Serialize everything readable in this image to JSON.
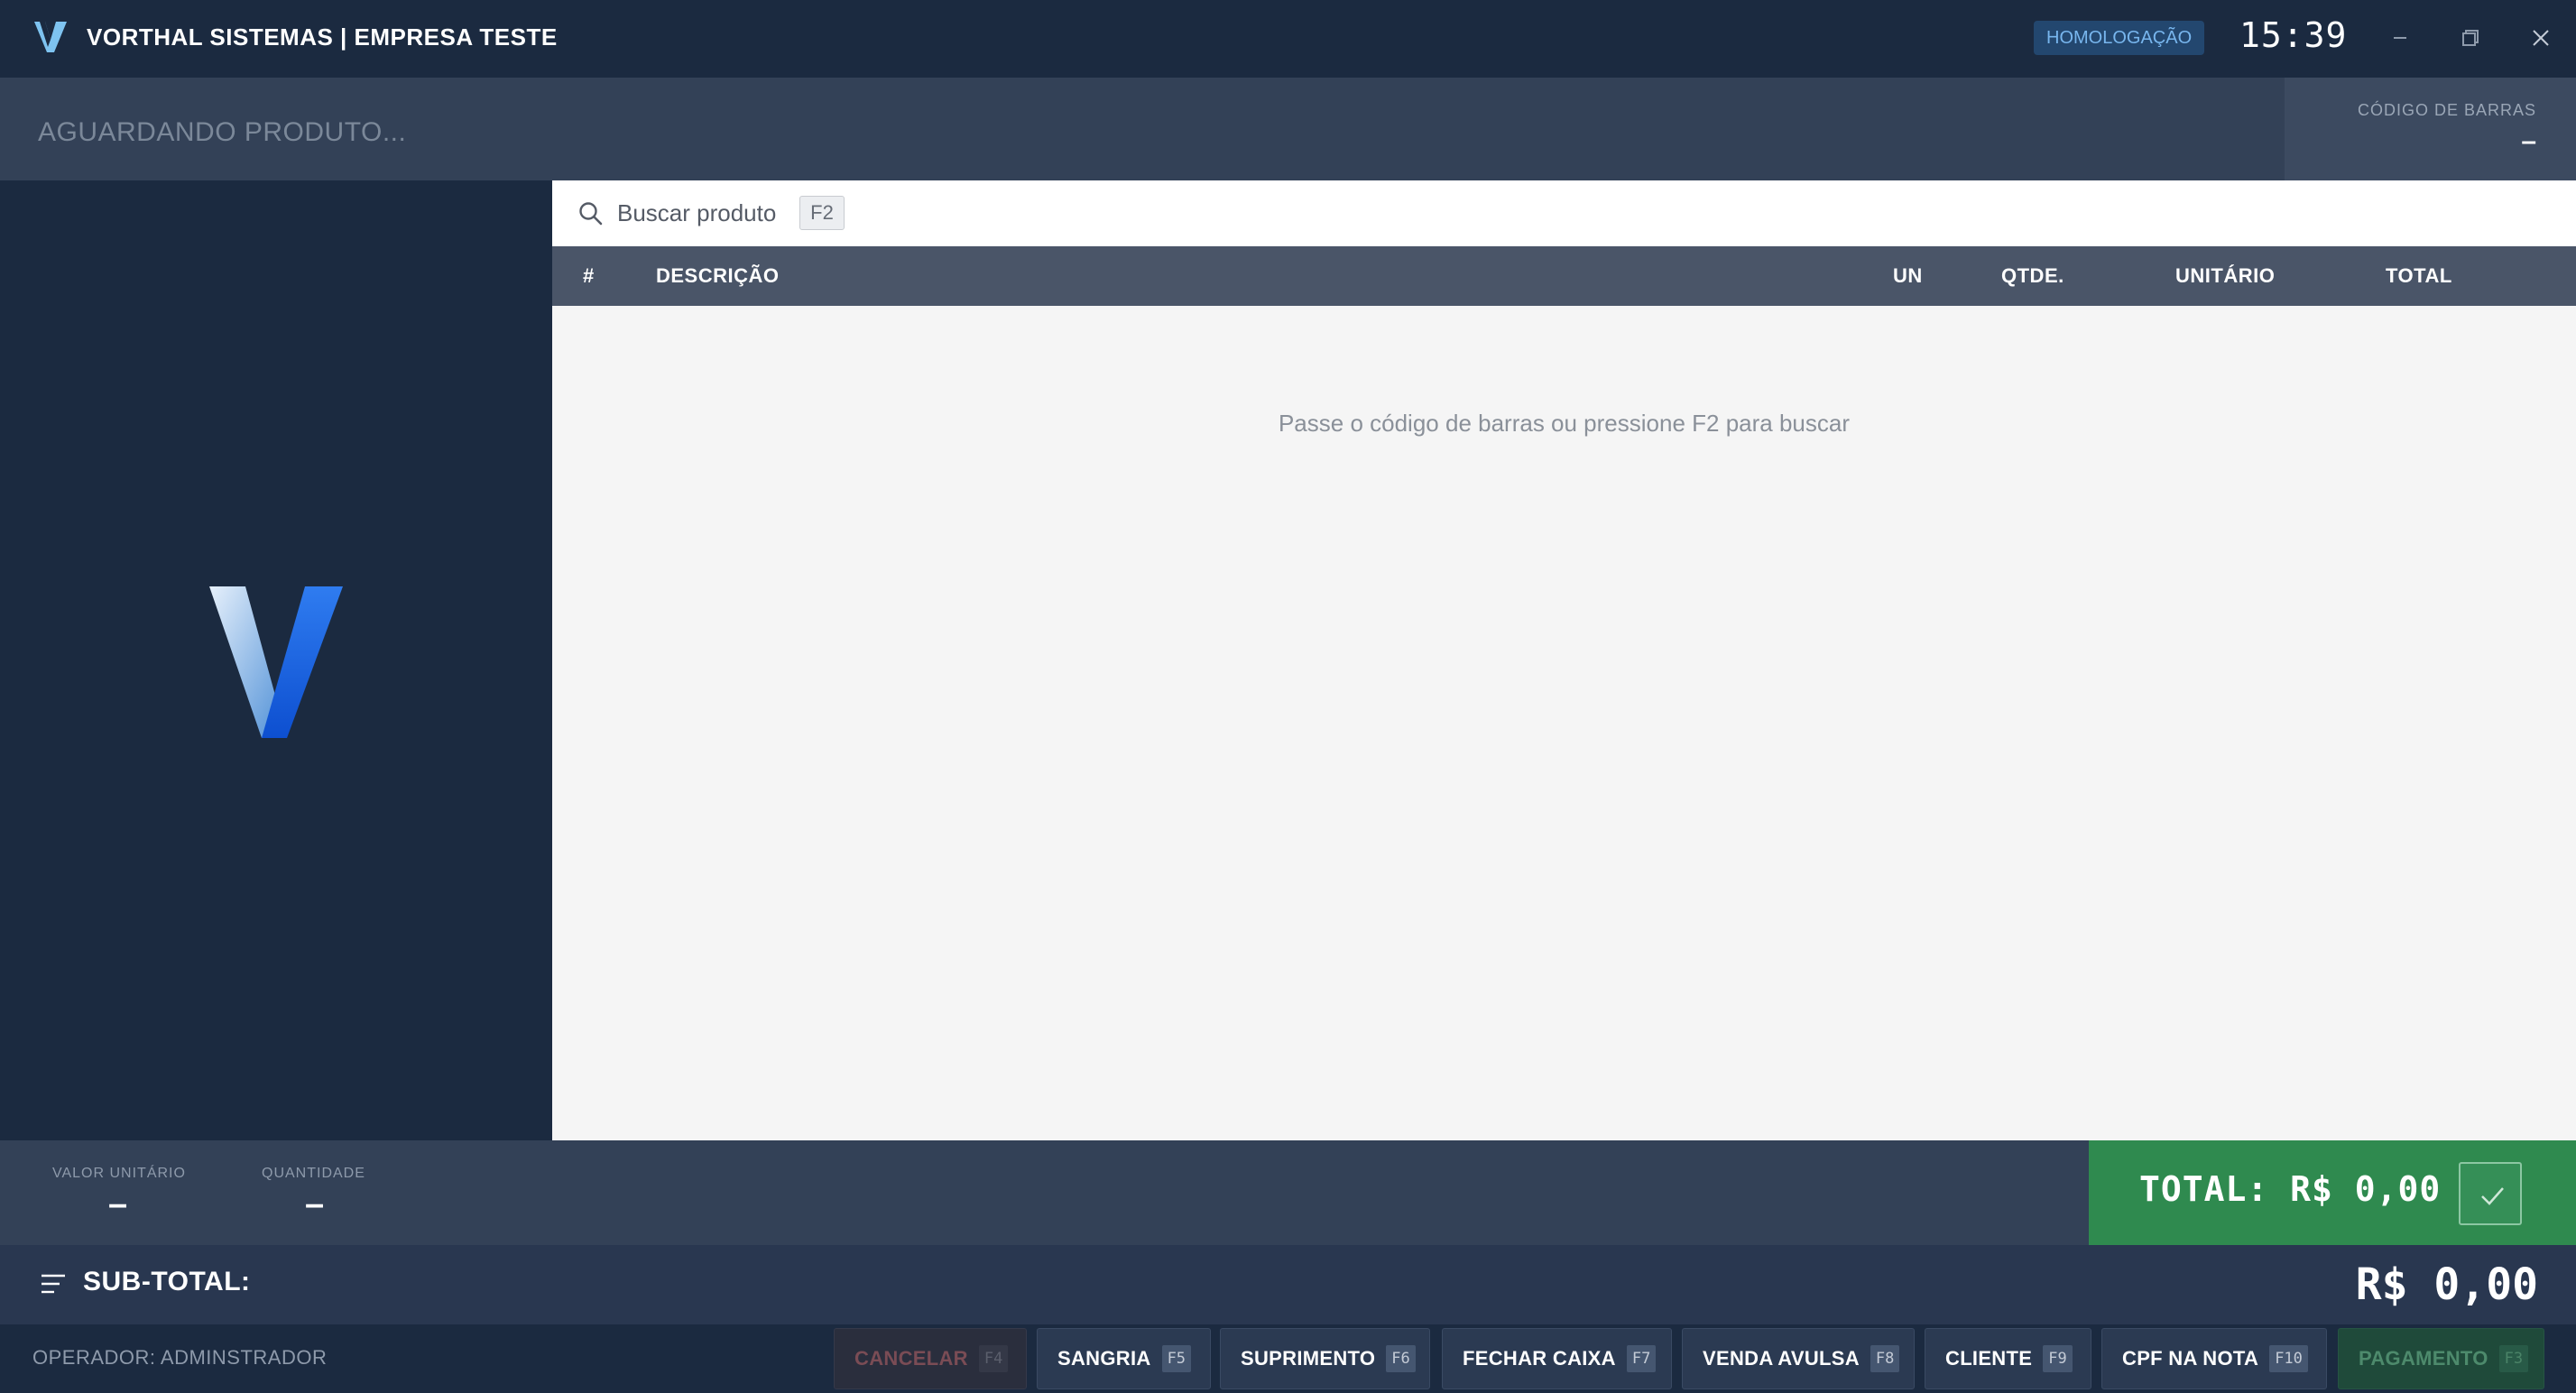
{
  "titlebar": {
    "title": "VORTHAL SISTEMAS | EMPRESA TESTE",
    "environment": "HOMOLOGAÇÃO",
    "clock": "15:39",
    "logo_icon": "vorthal-v-logo"
  },
  "product_bar": {
    "placeholder": "AGUARDANDO PRODUTO...",
    "barcode_label": "CÓDIGO DE BARRAS",
    "barcode_value": "–"
  },
  "search": {
    "label": "Buscar produto",
    "shortcut": "F2"
  },
  "table": {
    "columns": [
      "#",
      "DESCRIÇÃO",
      "UN",
      "QTDE.",
      "UNITÁRIO",
      "TOTAL"
    ],
    "rows": [],
    "empty_message": "Passe o código de barras ou pressione F2 para buscar"
  },
  "info": {
    "unit_value_label": "VALOR UNITÁRIO",
    "unit_value": "–",
    "quantity_label": "QUANTIDADE",
    "quantity": "–"
  },
  "total": {
    "text": "TOTAL: R$ 0,00"
  },
  "subtotal": {
    "label": "SUB-TOTAL:",
    "value": "R$ 0,00"
  },
  "footer": {
    "operator": "OPERADOR: ADMINSTRADOR",
    "buttons": [
      {
        "label": "CANCELAR",
        "key": "F4"
      },
      {
        "label": "SANGRIA",
        "key": "F5"
      },
      {
        "label": "SUPRIMENTO",
        "key": "F6"
      },
      {
        "label": "FECHAR CAIXA",
        "key": "F7"
      },
      {
        "label": "VENDA AVULSA",
        "key": "F8"
      },
      {
        "label": "CLIENTE",
        "key": "F9"
      },
      {
        "label": "CPF NA NOTA",
        "key": "F10"
      },
      {
        "label": "PAGAMENTO",
        "key": "F3"
      }
    ]
  },
  "colors": {
    "background": "#1b2a40",
    "total_green": "#2f8a4f",
    "badge_blue": "#78b6ee"
  }
}
